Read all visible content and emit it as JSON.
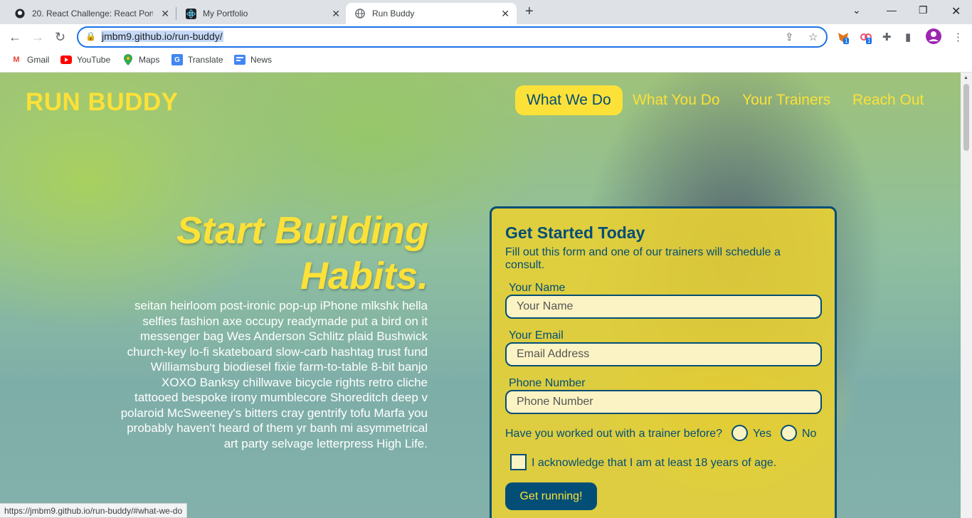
{
  "browser": {
    "tabs": [
      {
        "title": "20. React Challenge: React Portfo",
        "icon": "github-icon"
      },
      {
        "title": "My Portfolio",
        "icon": "react-icon"
      },
      {
        "title": "Run Buddy",
        "icon": "globe-icon"
      }
    ],
    "url": "jmbm9.github.io/run-buddy/",
    "bookmarks": [
      {
        "label": "Gmail",
        "icon": "gmail-icon"
      },
      {
        "label": "YouTube",
        "icon": "youtube-icon"
      },
      {
        "label": "Maps",
        "icon": "maps-icon"
      },
      {
        "label": "Translate",
        "icon": "translate-icon"
      },
      {
        "label": "News",
        "icon": "news-icon"
      }
    ],
    "extension_badges": [
      "1",
      "1"
    ],
    "status_url": "https://jmbm9.github.io/run-buddy/#what-we-do"
  },
  "site": {
    "logo": "RUN BUDDY",
    "nav": [
      "What We Do",
      "What You Do",
      "Your Trainers",
      "Reach Out"
    ],
    "active_nav": "What We Do",
    "hero": {
      "title_line1": "Start Building",
      "title_line2": "Habits.",
      "body": "seitan heirloom post-ironic pop-up iPhone mlkshk hella selfies fashion axe occupy readymade put a bird on it messenger bag Wes Anderson Schlitz plaid Bushwick church-key lo-fi skateboard slow-carb hashtag trust fund Williamsburg biodiesel fixie farm-to-table 8-bit banjo XOXO Banksy chillwave bicycle rights retro cliche tattooed bespoke irony mumblecore Shoreditch deep v polaroid McSweeney's bitters cray gentrify tofu Marfa you probably haven't heard of them yr banh mi asymmetrical art party selvage letterpress High Life."
    },
    "form": {
      "title": "Get Started Today",
      "subtitle": "Fill out this form and one of our trainers will schedule a consult.",
      "name_label": "Your Name",
      "name_placeholder": "Your Name",
      "email_label": "Your Email",
      "email_placeholder": "Email Address",
      "phone_label": "Phone Number",
      "phone_placeholder": "Phone Number",
      "trainer_question": "Have you worked out with a trainer before?",
      "yes": "Yes",
      "no": "No",
      "age_ack": "I acknowledge that I am at least 18 years of age.",
      "submit": "Get running!"
    }
  },
  "colors": {
    "yellow": "#fce138",
    "navy": "#024e76"
  }
}
